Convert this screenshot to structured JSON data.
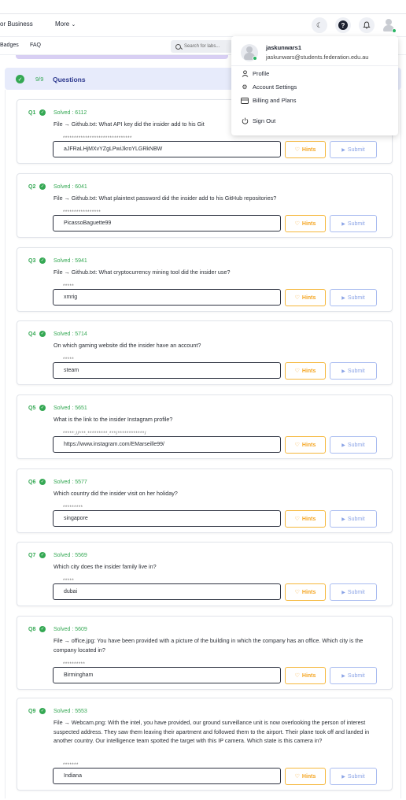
{
  "topnav": {
    "for_business": "or Business",
    "more": "More",
    "more_arrow": "⌄"
  },
  "subnav": {
    "badges": "Badges",
    "faq": "FAQ",
    "search_placeholder": "Search for labs..."
  },
  "questions_header": {
    "count": "9/9",
    "title": "Questions"
  },
  "buttons": {
    "hints": "Hints",
    "submit": "Submit"
  },
  "questions": [
    {
      "num": "Q1",
      "solved": "Solved : 6112",
      "text": "File → Github.txt: What API key did the insider add to his Git",
      "mask": "*******************************",
      "answer": "aJFRaLHjMXvYZgLPwiJkroYLGRkNBW"
    },
    {
      "num": "Q2",
      "solved": "Solved : 6041",
      "text": "File → Github.txt: What plaintext password did the insider add to his GitHub repositories?",
      "mask": "*****************",
      "answer": "PicassoBaguette99"
    },
    {
      "num": "Q3",
      "solved": "Solved : 5941",
      "text": "File → Github.txt: What cryptocurrency mining tool did the insider use?",
      "mask": "*****",
      "answer": "xmrig"
    },
    {
      "num": "Q4",
      "solved": "Solved : 5714",
      "text": "On which gaming website did the insider have an account?",
      "mask": "*****",
      "answer": "steam"
    },
    {
      "num": "Q5",
      "solved": "Solved : 5651",
      "text": "What is the link to the insider Instagram profile?",
      "mask": "*****://***.*********.***/************/",
      "answer": "https://www.instagram.com/EMarseille99/"
    },
    {
      "num": "Q6",
      "solved": "Solved : 5577",
      "text": "Which country did the insider visit on her holiday?",
      "mask": "*********",
      "answer": "singapore"
    },
    {
      "num": "Q7",
      "solved": "Solved : 5569",
      "text": "Which city does the insider family live in?",
      "mask": "*****",
      "answer": "dubai"
    },
    {
      "num": "Q8",
      "solved": "Solved : 5609",
      "text": "File → office.jpg: You have been provided with a picture of the building in which the company has an office. Which city is the company located in?",
      "mask": "**********",
      "answer": "Birmingham"
    },
    {
      "num": "Q9",
      "solved": "Solved : 5553",
      "text": "File → Webcam.png: With the intel, you have provided, our ground surveillance unit is now overlooking the person of interest suspected address. They saw them leaving their apartment and followed them to the airport. Their plane took off and landed in another country. Our intelligence team spotted the target with this IP camera. Which state is this camera in?",
      "mask": "*******",
      "answer": "Indiana"
    }
  ],
  "user_menu": {
    "username": "jaskunwars1",
    "email": "jaskunwars@students.federation.edu.au",
    "items": [
      {
        "label": "Profile",
        "icon": "person-icon"
      },
      {
        "label": "Account Settings",
        "icon": "gear-icon"
      },
      {
        "label": "Billing and Plans",
        "icon": "card-icon"
      },
      {
        "label": "Sign Out",
        "icon": "power-icon"
      }
    ]
  },
  "colors": {
    "accent_green": "#34a853",
    "hints_orange": "#f5a623",
    "submit_blue": "#8aa3e6",
    "header_bg": "#e7ebfb"
  }
}
